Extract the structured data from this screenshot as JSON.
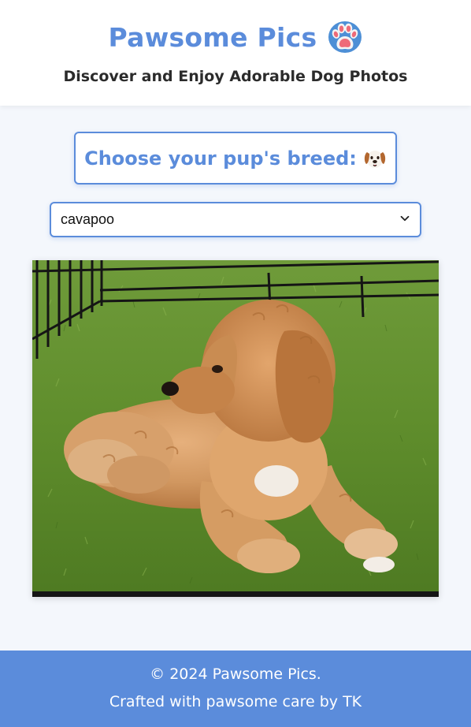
{
  "header": {
    "title": "Pawsome Pics",
    "title_icon": "paw-print-icon",
    "tagline": "Discover and Enjoy Adorable Dog Photos"
  },
  "chooser": {
    "label": "Choose your pup's breed:",
    "icon": "dog-face-icon"
  },
  "breed_select": {
    "selected": "cavapoo",
    "icon": "chevron-down-icon"
  },
  "photo": {
    "subject": "cavapoo-dog-photo"
  },
  "footer": {
    "copyright": "© 2024 Pawsome Pics.",
    "credit": "Crafted with pawsome care by TK"
  },
  "colors": {
    "accent": "#5b8cdb",
    "background": "#f4f7fc",
    "header_bg": "#ffffff",
    "footer_text": "#ffffff"
  }
}
